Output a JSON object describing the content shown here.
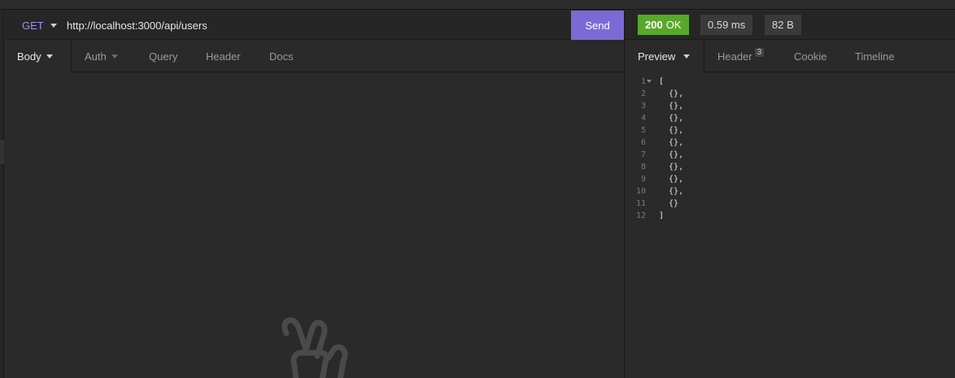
{
  "request": {
    "method": "GET",
    "url": "http://localhost:3000/api/users",
    "send_label": "Send",
    "tabs": [
      {
        "label": "Body"
      },
      {
        "label": "Auth"
      },
      {
        "label": "Query"
      },
      {
        "label": "Header"
      },
      {
        "label": "Docs"
      }
    ]
  },
  "response": {
    "status_code": "200",
    "status_text": "OK",
    "time": "0.59 ms",
    "size": "82 B",
    "tabs": [
      {
        "label": "Preview"
      },
      {
        "label": "Header",
        "count": "3"
      },
      {
        "label": "Cookie"
      },
      {
        "label": "Timeline"
      }
    ],
    "lines": [
      {
        "n": "1",
        "text": "["
      },
      {
        "n": "2",
        "text": "  {},"
      },
      {
        "n": "3",
        "text": "  {},"
      },
      {
        "n": "4",
        "text": "  {},"
      },
      {
        "n": "5",
        "text": "  {},"
      },
      {
        "n": "6",
        "text": "  {},"
      },
      {
        "n": "7",
        "text": "  {},"
      },
      {
        "n": "8",
        "text": "  {},"
      },
      {
        "n": "9",
        "text": "  {},"
      },
      {
        "n": "10",
        "text": "  {},"
      },
      {
        "n": "11",
        "text": "  {}"
      },
      {
        "n": "12",
        "text": "]"
      }
    ]
  },
  "icons": {
    "method_dropdown": "chevron-down-icon",
    "empty_state": "peace-hand-icon"
  },
  "colors": {
    "method": "#a58cf2",
    "send": "#7b6ad6",
    "status_ok": "#59a82b"
  }
}
